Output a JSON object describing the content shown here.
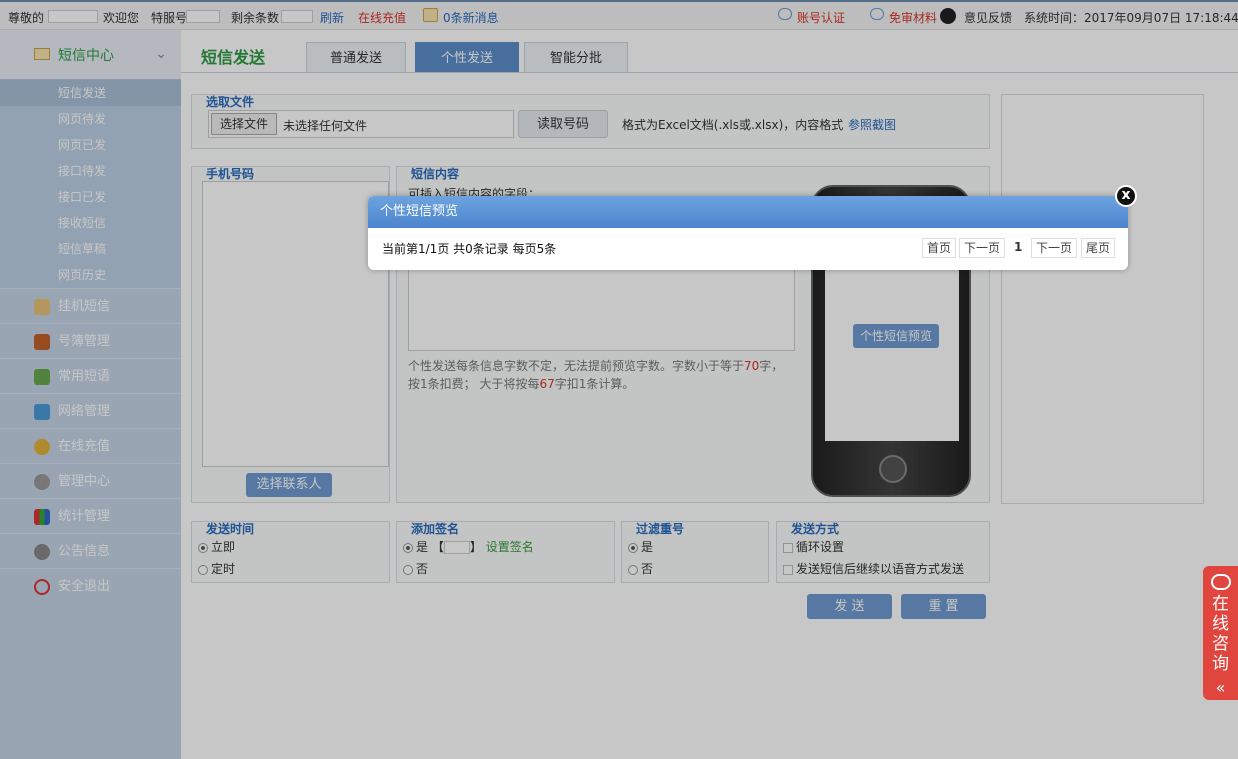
{
  "topbar": {
    "greeting": "尊敬的",
    "welcome": "欢迎您",
    "special_label": "特服号",
    "remaining_label": "剩余条数",
    "refresh": "刷新",
    "recharge": "在线充值",
    "messages": "0条新消息",
    "account_verify": "账号认证",
    "review_materials": "免审材料",
    "feedback": "意见反馈",
    "system_time": "系统时间：2017年09月07日 17:18:44"
  },
  "sidebar": {
    "header": "短信中心",
    "sub_items": [
      "短信发送",
      "网页待发",
      "网页已发",
      "接口待发",
      "接口已发",
      "接收短信",
      "短信草稿",
      "网页历史"
    ],
    "groups": [
      "挂机短信",
      "号簿管理",
      "常用短语",
      "网络管理",
      "在线充值",
      "管理中心",
      "统计管理",
      "公告信息",
      "安全退出"
    ]
  },
  "main": {
    "title": "短信发送",
    "tabs": [
      "普通发送",
      "个性发送",
      "智能分批"
    ],
    "file_section": {
      "title": "选取文件",
      "choose_file": "选择文件",
      "no_file": "未选择任何文件",
      "read_button": "读取号码",
      "format_hint": "格式为Excel文档(.xls或.xlsx)，内容格式",
      "reference_link": "参照截图"
    },
    "phone_section": {
      "title": "手机号码",
      "select_contacts": "选择联系人"
    },
    "sms_section": {
      "title": "短信内容",
      "insert_hint": "可插入短信内容的字段：",
      "note_part1": "个性发送每条信息字数不定，无法提前预览字数。字数小于等于",
      "limit1": "70",
      "note_part2": "字，按1条扣费； 大于将按每",
      "limit2": "67",
      "note_part3": "字扣1条计算。",
      "preview_button": "个性短信预览"
    },
    "send_time": {
      "title": "发送时间",
      "opt1": "立即",
      "opt2": "定时"
    },
    "signature": {
      "title": "添加签名",
      "opt_yes": "是",
      "bracket_l": "【",
      "bracket_r": "】",
      "set_link": "设置签名",
      "opt_no": "否"
    },
    "filter": {
      "title": "过滤重号",
      "opt_yes": "是",
      "opt_no": "否"
    },
    "send_mode": {
      "title": "发送方式",
      "opt1": "循环设置",
      "opt2": "发送短信后继续以语音方式发送"
    },
    "send_button": "发 送",
    "reset_button": "重 置"
  },
  "modal": {
    "title": "个性短信预览",
    "info": "当前第1/1页 共0条记录 每页5条",
    "first": "首页",
    "next1": "下一页",
    "page": "1",
    "next2": "下一页",
    "last": "尾页",
    "close": "x"
  },
  "consult": {
    "label": "在线咨询",
    "arrow": "«"
  }
}
